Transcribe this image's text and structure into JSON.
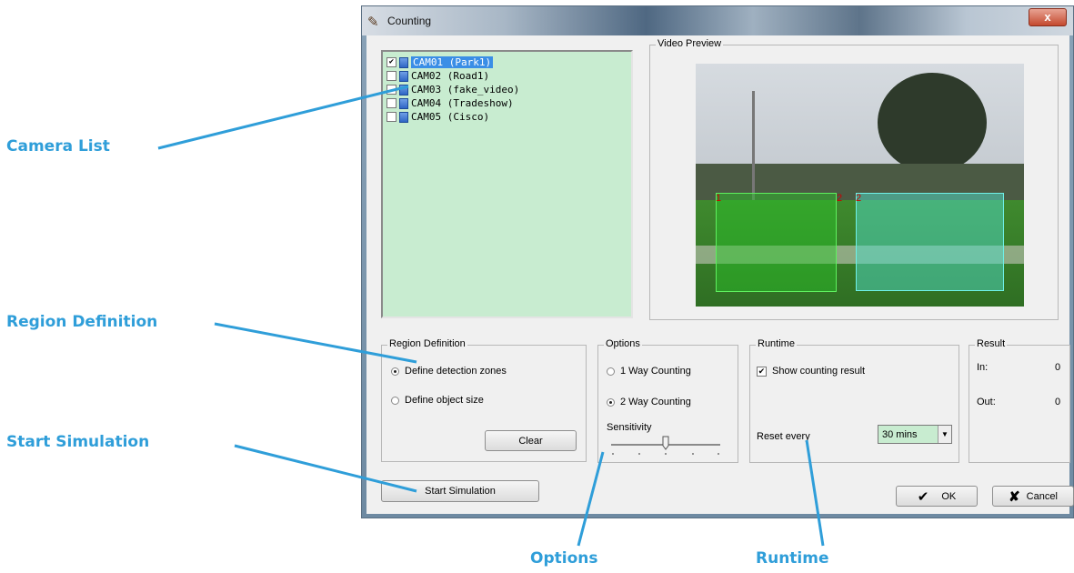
{
  "window": {
    "title": "Counting",
    "close_glyph": "x"
  },
  "camera_list": [
    {
      "label": "CAM01 (Park1)",
      "checked": true,
      "selected": true
    },
    {
      "label": "CAM02 (Road1)",
      "checked": false,
      "selected": false
    },
    {
      "label": "CAM03 (fake_video)",
      "checked": false,
      "selected": false
    },
    {
      "label": "CAM04 (Tradeshow)",
      "checked": false,
      "selected": false
    },
    {
      "label": "CAM05 (Cisco)",
      "checked": false,
      "selected": false
    }
  ],
  "video_preview": {
    "legend": "Video Preview",
    "zone1_label": "1",
    "zone2_label": "2",
    "zone2_alt_label": "2"
  },
  "region_definition": {
    "legend": "Region Definition",
    "option1": "Define detection zones",
    "option2": "Define object size",
    "selected": 1,
    "clear_label": "Clear"
  },
  "options": {
    "legend": "Options",
    "one_way": "1 Way Counting",
    "two_way": "2 Way Counting",
    "selected": 2,
    "sensitivity_label": "Sensitivity",
    "sensitivity_value": 0.5
  },
  "runtime": {
    "legend": "Runtime",
    "show_result_label": "Show counting result",
    "show_result_checked": true,
    "reset_label": "Reset every",
    "reset_value": "30 mins"
  },
  "result": {
    "legend": "Result",
    "in_label": "In:",
    "in_value": "0",
    "out_label": "Out:",
    "out_value": "0"
  },
  "buttons": {
    "start_simulation": "Start Simulation",
    "ok": "OK",
    "cancel": "Cancel"
  },
  "annotations": {
    "camera_list": "Camera List",
    "region_definition": "Region Definition",
    "start_simulation": "Start Simulation",
    "options": "Options",
    "runtime": "Runtime",
    "color": "#2f9ed9"
  }
}
